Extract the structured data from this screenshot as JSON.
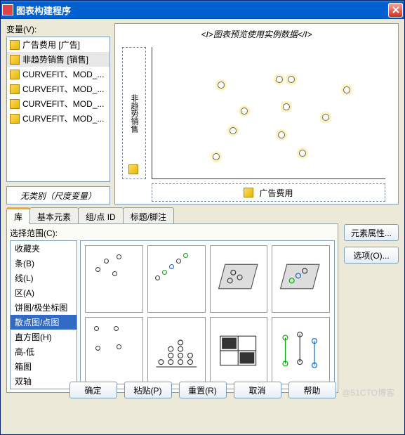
{
  "window": {
    "title": "图表构建程序"
  },
  "variables": {
    "label": "变量(V):",
    "items": [
      "广告费用 [广告]",
      "非趋势销售 [销售]",
      "CURVEFIT、MOD_...",
      "CURVEFIT、MOD_...",
      "CURVEFIT、MOD_...",
      "CURVEFIT、MOD_..."
    ],
    "no_category": "无类别（尺度变量）"
  },
  "preview": {
    "title": "<I>图表预览使用实例数据</I>",
    "y_label": "非趋势销售",
    "x_label": "广告费用"
  },
  "tabs": {
    "items": [
      "库",
      "基本元素",
      "组/点 ID",
      "标题/脚注"
    ],
    "active": 0
  },
  "library": {
    "range_label": "选择范围(C):",
    "types": [
      "收藏夹",
      "条(B)",
      "线(L)",
      "区(A)",
      "饼图/极坐标图",
      "散点图/点图",
      "直方图(H)",
      "高-低",
      "箱图",
      "双轴"
    ],
    "selected": 5
  },
  "side_buttons": {
    "properties": "元素属性...",
    "options": "选项(O)..."
  },
  "footer": {
    "ok": "确定",
    "paste": "粘贴(P)",
    "reset": "重置(R)",
    "cancel": "取消",
    "help": "帮助"
  },
  "watermark": "@51CTO博客",
  "chart_data": {
    "type": "scatter",
    "title": "图表预览使用实例数据",
    "xlabel": "广告费用",
    "ylabel": "非趋势销售",
    "xlim": [
      0,
      100
    ],
    "ylim": [
      0,
      100
    ],
    "points": [
      {
        "x": 30,
        "y": 70
      },
      {
        "x": 55,
        "y": 75
      },
      {
        "x": 60,
        "y": 75
      },
      {
        "x": 84,
        "y": 68
      },
      {
        "x": 40,
        "y": 50
      },
      {
        "x": 58,
        "y": 53
      },
      {
        "x": 75,
        "y": 45
      },
      {
        "x": 35,
        "y": 35
      },
      {
        "x": 56,
        "y": 32
      },
      {
        "x": 65,
        "y": 18
      },
      {
        "x": 28,
        "y": 15
      }
    ]
  }
}
